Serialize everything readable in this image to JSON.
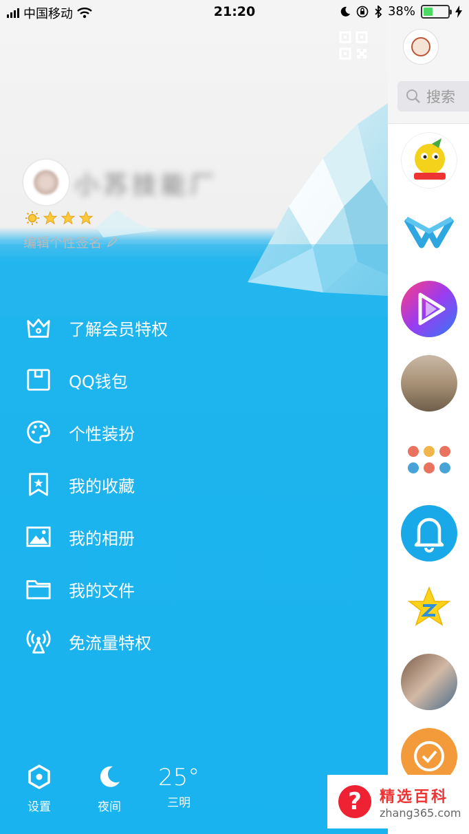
{
  "status_bar": {
    "carrier": "中国移动",
    "time": "21:20",
    "battery_percent": "38%",
    "battery_level": 0.38
  },
  "profile": {
    "nickname": "小苏技能厂",
    "signature": "编辑个性签名",
    "star_count": 4
  },
  "menu": {
    "items": [
      {
        "label": "了解会员特权",
        "icon": "crown-icon"
      },
      {
        "label": "QQ钱包",
        "icon": "wallet-icon"
      },
      {
        "label": "个性装扮",
        "icon": "palette-icon"
      },
      {
        "label": "我的收藏",
        "icon": "bookmark-star-icon"
      },
      {
        "label": "我的相册",
        "icon": "photo-icon"
      },
      {
        "label": "我的文件",
        "icon": "folder-icon"
      },
      {
        "label": "免流量特权",
        "icon": "signal-tower-icon"
      }
    ]
  },
  "bottom_bar": {
    "settings_label": "设置",
    "night_label": "夜间",
    "temperature": "25°",
    "city": "三明"
  },
  "right_panel": {
    "search_placeholder": "搜索"
  },
  "watermark": {
    "title": "精选百科",
    "url": "zhang365.com"
  },
  "colors": {
    "drawer_blue": "#19b3ef",
    "battery_green": "#4cd964"
  }
}
